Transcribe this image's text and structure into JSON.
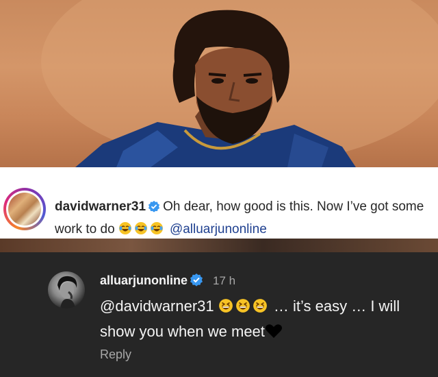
{
  "instagram_comment": {
    "username": "davidwarner31",
    "text_prefix": "Oh dear, how good is this. Now I’ve got some work to do",
    "mention": "@alluarjunonline",
    "emoji_count": 3,
    "icons": [
      "verified-badge-icon",
      "tears-of-joy-emoji"
    ]
  },
  "reply": {
    "username": "alluarjunonline",
    "time": "17 h",
    "mention": "@davidwarner31",
    "text_after_emoji": "… it’s easy … I will show you when we meet",
    "reply_label": "Reply",
    "icons": [
      "verified-badge-icon",
      "grinning-squinting-emoji",
      "black-heart-icon"
    ]
  },
  "colors": {
    "verified_blue": "#3897f0",
    "mention_blue": "#1e3f8f",
    "dark_bg": "#262626",
    "muted_text": "#a8a8a8"
  }
}
